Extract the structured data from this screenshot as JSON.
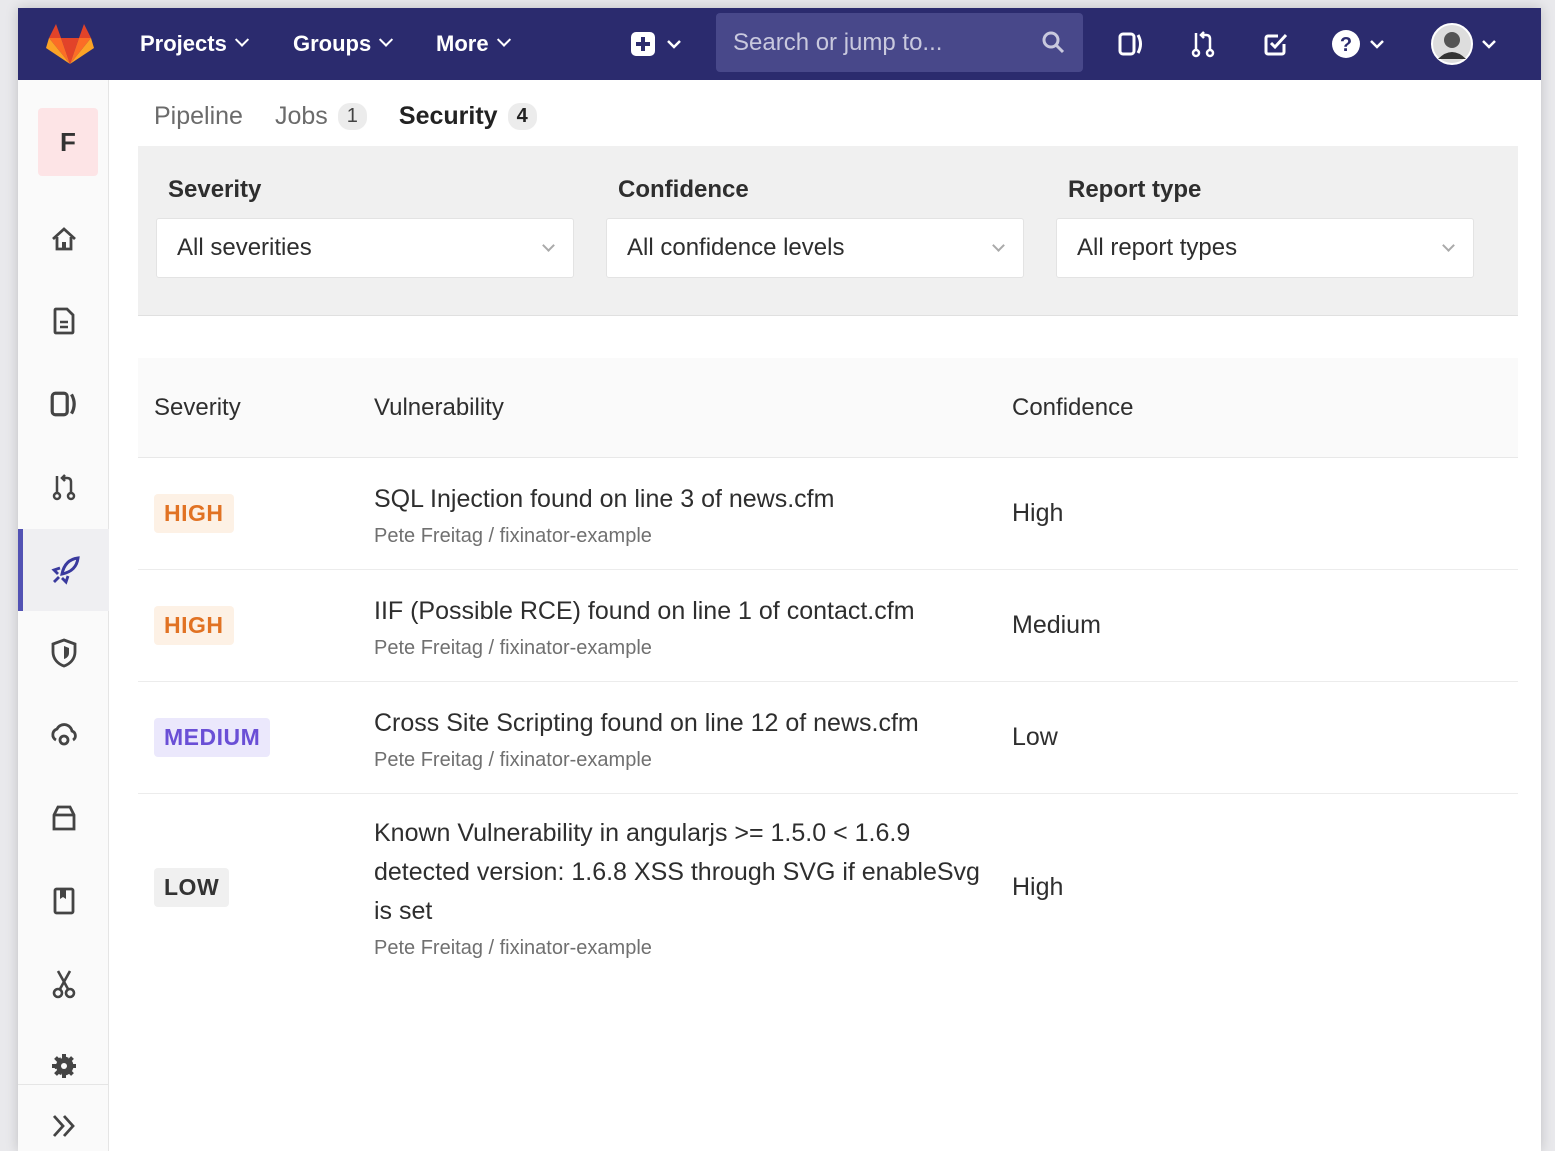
{
  "colors": {
    "navbar": "#2b2b6e",
    "accent": "#6666c4",
    "high": "#e17223",
    "medium": "#6a4fd6",
    "low": "#333333"
  },
  "navbar": {
    "menus": [
      {
        "label": "Projects",
        "icon": "chevron-down-icon"
      },
      {
        "label": "Groups",
        "icon": "chevron-down-icon"
      },
      {
        "label": "More",
        "icon": "chevron-down-icon"
      }
    ],
    "search_placeholder": "Search or jump to..."
  },
  "sidebar": {
    "project_letter": "F",
    "items": [
      {
        "name": "home-icon"
      },
      {
        "name": "file-icon"
      },
      {
        "name": "issues-icon"
      },
      {
        "name": "merge-request-icon"
      },
      {
        "name": "rocket-icon"
      },
      {
        "name": "shield-icon"
      },
      {
        "name": "cloud-gear-icon"
      },
      {
        "name": "package-icon"
      },
      {
        "name": "book-icon"
      },
      {
        "name": "scissors-icon"
      },
      {
        "name": "gear-icon"
      },
      {
        "name": "double-chevron-icon"
      }
    ]
  },
  "tabs": [
    {
      "label": "Pipeline",
      "count": ""
    },
    {
      "label": "Jobs",
      "count": "1"
    },
    {
      "label": "Security",
      "count": "4",
      "active": true
    }
  ],
  "filters": {
    "severity": {
      "label": "Severity",
      "value": "All severities"
    },
    "confidence": {
      "label": "Confidence",
      "value": "All confidence levels"
    },
    "report_type": {
      "label": "Report type",
      "value": "All report types"
    }
  },
  "table": {
    "headers": {
      "severity": "Severity",
      "vulnerability": "Vulnerability",
      "confidence": "Confidence"
    },
    "rows": [
      {
        "severity": "HIGH",
        "title": "SQL Injection found on line 3 of news.cfm",
        "project": "Pete Freitag / fixinator-example",
        "confidence": "High"
      },
      {
        "severity": "HIGH",
        "title": "IIF (Possible RCE) found on line 1 of contact.cfm",
        "project": "Pete Freitag / fixinator-example",
        "confidence": "Medium"
      },
      {
        "severity": "MEDIUM",
        "title": "Cross Site Scripting found on line 12 of news.cfm",
        "project": "Pete Freitag / fixinator-example",
        "confidence": "Low"
      },
      {
        "severity": "LOW",
        "title": "Known Vulnerability in angularjs >= 1.5.0 < 1.6.9 detected version: 1.6.8 XSS through SVG if enableSvg is set",
        "project": "Pete Freitag / fixinator-example",
        "confidence": "High"
      }
    ]
  }
}
